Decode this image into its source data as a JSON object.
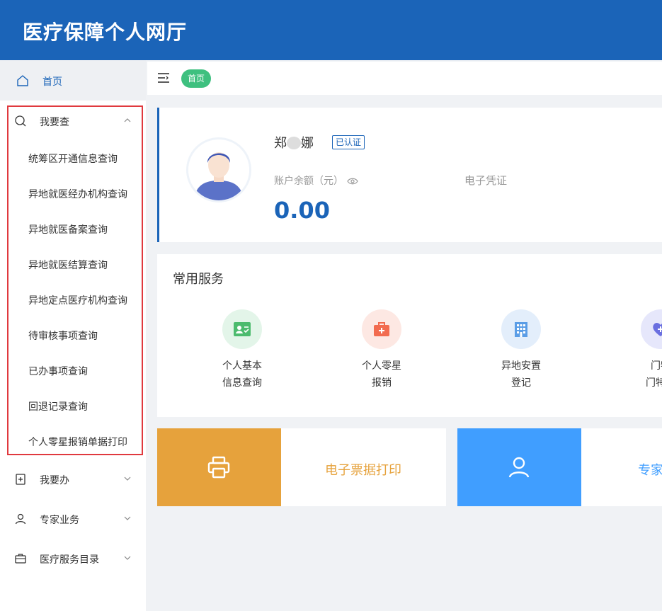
{
  "app": {
    "title": "医疗保障个人网厅"
  },
  "sidebar": {
    "home_label": "首页",
    "query_group": {
      "label": "我要查",
      "items": [
        "统筹区开通信息查询",
        "异地就医经办机构查询",
        "异地就医备案查询",
        "异地就医结算查询",
        "异地定点医疗机构查询",
        "待审核事项查询",
        "已办事项查询",
        "回退记录查询",
        "个人零星报销单据打印"
      ]
    },
    "groups": [
      {
        "label": "我要办",
        "icon": "add-document-icon"
      },
      {
        "label": "专家业务",
        "icon": "user-icon"
      },
      {
        "label": "医疗服务目录",
        "icon": "briefcase-icon"
      }
    ]
  },
  "breadcrumb": {
    "tag": "首页"
  },
  "user_card": {
    "name_first": "郑",
    "name_last": "娜",
    "verified_badge": "已认证",
    "balance_label": "账户余额（元）",
    "balance_value": "0.00",
    "credential_label": "电子凭证"
  },
  "services": {
    "title": "常用服务",
    "items": [
      {
        "line1": "个人基本",
        "line2": "信息查询",
        "icon": "id-card-icon",
        "bg": "#e3f5e9",
        "color": "#4cbb6e"
      },
      {
        "line1": "个人零星",
        "line2": "报销",
        "icon": "medical-kit-icon",
        "bg": "#fde8e3",
        "color": "#f26b4f"
      },
      {
        "line1": "异地安置",
        "line2": "登记",
        "icon": "building-icon",
        "bg": "#e3eefb",
        "color": "#5a9de6"
      },
      {
        "line1": "门特",
        "line2": "门特病",
        "icon": "heart-plus-icon",
        "bg": "#e6e7fb",
        "color": "#6a6fe0"
      }
    ]
  },
  "tiles": [
    {
      "label": "电子票据打印",
      "icon": "printer-icon",
      "block_color": "#e6a23c",
      "text_color": "#e6a23c"
    },
    {
      "label": "专家",
      "icon": "person-icon",
      "block_color": "#409eff",
      "text_color": "#409eff"
    }
  ]
}
